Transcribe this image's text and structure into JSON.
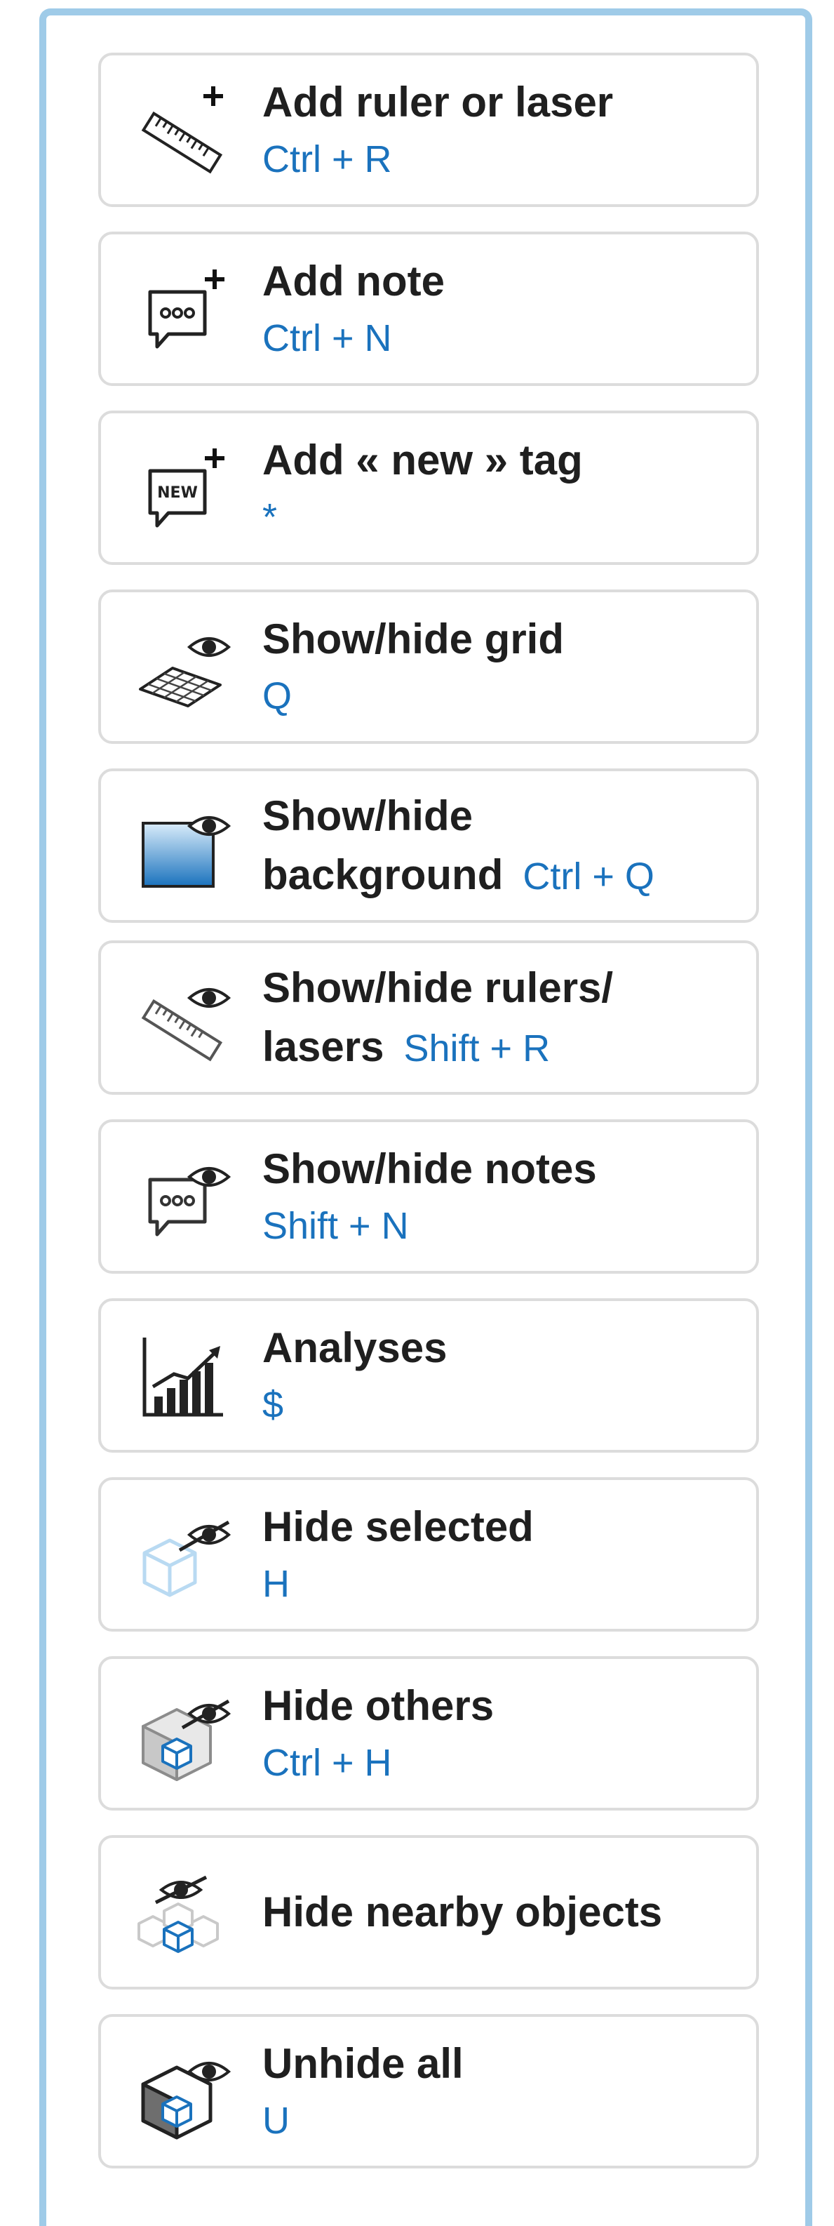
{
  "colors": {
    "accent": "#1a72bd",
    "panel_border": "#9fcbe8",
    "card_border": "#dcdcdc",
    "title": "#1f1f1f"
  },
  "items": [
    {
      "title": "Add ruler or laser",
      "shortcut": "Ctrl + R",
      "icon": "ruler-add-icon"
    },
    {
      "title": "Add note",
      "shortcut": "Ctrl + N",
      "icon": "note-add-icon"
    },
    {
      "title": "Add « new » tag",
      "shortcut": "*",
      "icon": "new-tag-add-icon"
    },
    {
      "title": "Show/hide grid",
      "shortcut": "Q",
      "icon": "grid-eye-icon"
    },
    {
      "title_line1": "Show/hide",
      "title_line2": "background",
      "shortcut": "Ctrl + Q",
      "icon": "background-eye-icon"
    },
    {
      "title_line1": "Show/hide rulers/",
      "title_line2": "lasers",
      "shortcut": "Shift + R",
      "icon": "ruler-eye-icon"
    },
    {
      "title": "Show/hide notes",
      "shortcut": "Shift + N",
      "icon": "note-eye-icon"
    },
    {
      "title": "Analyses",
      "shortcut": "$",
      "icon": "bar-chart-icon"
    },
    {
      "title": "Hide selected",
      "shortcut": "H",
      "icon": "hide-selected-icon"
    },
    {
      "title": "Hide others",
      "shortcut": "Ctrl + H",
      "icon": "hide-others-icon"
    },
    {
      "title": "Hide nearby objects",
      "icon": "hide-nearby-icon"
    },
    {
      "title": "Unhide all",
      "shortcut": "U",
      "icon": "unhide-all-icon"
    }
  ]
}
